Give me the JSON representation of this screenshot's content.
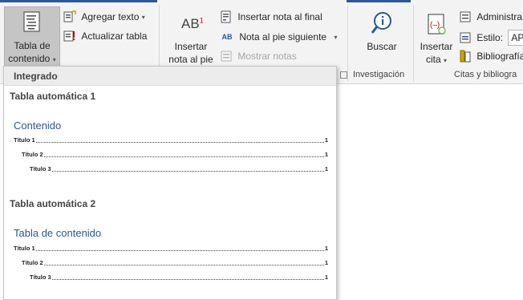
{
  "ribbon": {
    "toc_group": {
      "toc_button_line1": "Tabla de",
      "toc_button_line2": "contenido",
      "add_text_label": "Agregar texto",
      "update_table_label": "Actualizar tabla"
    },
    "footnotes_group": {
      "insert_footnote_symbol": "AB",
      "insert_footnote_sup": "1",
      "insert_footnote_line1": "Insertar",
      "insert_footnote_line2": "nota al pie",
      "insert_endnote_label": "Insertar nota al final",
      "next_footnote_label": "Nota al pie siguiente",
      "show_notes_label": "Mostrar notas"
    },
    "research_group": {
      "search_label": "Buscar",
      "group_label": "Investigación"
    },
    "citations_group": {
      "insert_citation_line1": "Insertar",
      "insert_citation_line2": "cita",
      "manage_label": "Administra",
      "style_label": "Estilo:",
      "style_value": "APA",
      "bibliography_label": "Bibliografía",
      "group_label": "Citas y bibliogra"
    },
    "accent_color": "#2b579a"
  },
  "dropdown": {
    "section_header": "Integrado",
    "options": [
      {
        "name": "Tabla automática 1",
        "heading": "Contenido",
        "entries": [
          {
            "text": "Título 1",
            "page": "1"
          },
          {
            "text": "Título 2",
            "page": "1"
          },
          {
            "text": "Título 3",
            "page": "1"
          }
        ]
      },
      {
        "name": "Tabla automática 2",
        "heading": "Tabla de contenido",
        "entries": [
          {
            "text": "Título 1",
            "page": "1"
          },
          {
            "text": "Título 2",
            "page": "1"
          },
          {
            "text": "Título 3",
            "page": "1"
          }
        ]
      }
    ]
  }
}
